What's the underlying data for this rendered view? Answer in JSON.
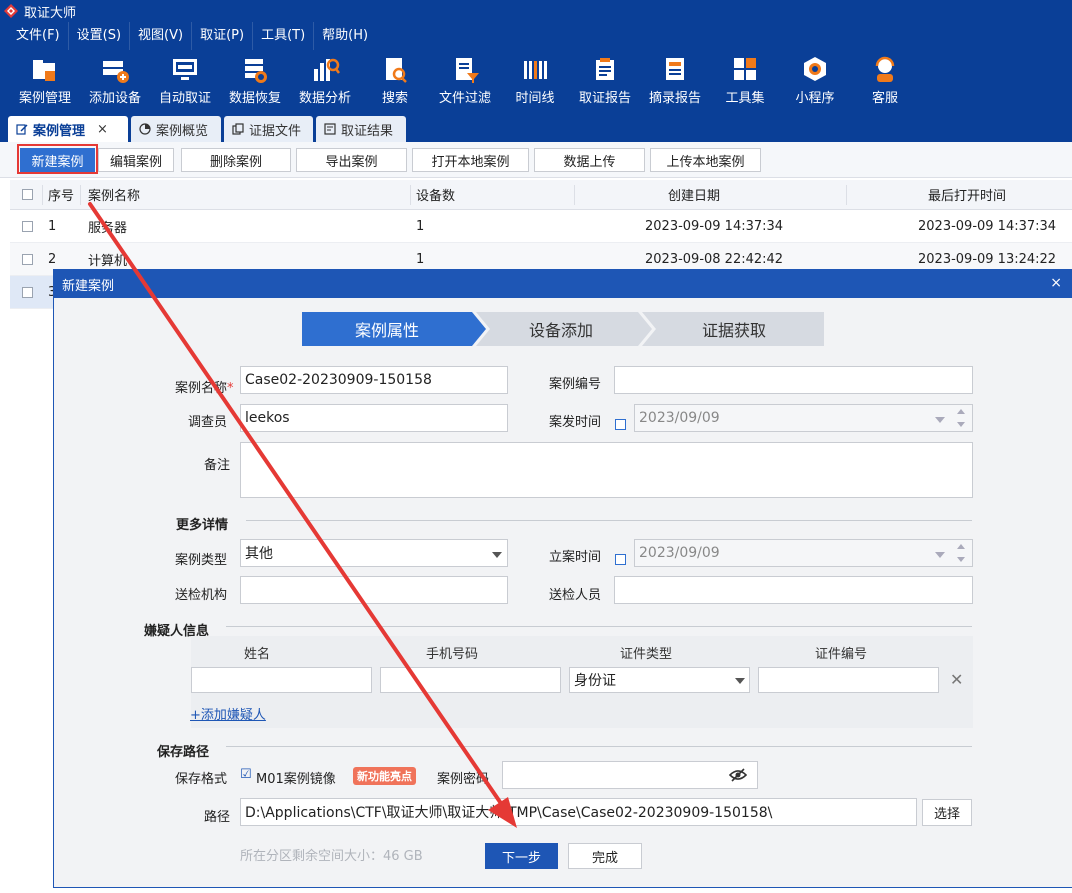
{
  "app": {
    "title": "取证大师"
  },
  "menu": [
    "文件(F)",
    "设置(S)",
    "视图(V)",
    "取证(P)",
    "工具(T)",
    "帮助(H)"
  ],
  "toolbar": [
    {
      "label": "案例管理",
      "icon": "folder-case-icon"
    },
    {
      "label": "添加设备",
      "icon": "add-device-icon"
    },
    {
      "label": "自动取证",
      "icon": "auto-monitor-icon"
    },
    {
      "label": "数据恢复",
      "icon": "data-recovery-icon"
    },
    {
      "label": "数据分析",
      "icon": "data-analysis-icon"
    },
    {
      "label": "搜索",
      "icon": "search-doc-icon"
    },
    {
      "label": "文件过滤",
      "icon": "file-filter-icon"
    },
    {
      "label": "时间线",
      "icon": "timeline-icon"
    },
    {
      "label": "取证报告",
      "icon": "report-icon"
    },
    {
      "label": "摘录报告",
      "icon": "excerpt-report-icon"
    },
    {
      "label": "工具集",
      "icon": "toolkit-icon"
    },
    {
      "label": "小程序",
      "icon": "mini-program-icon"
    },
    {
      "label": "客服",
      "icon": "customer-service-icon"
    }
  ],
  "tabs": [
    {
      "label": "案例管理",
      "icon": "edit-icon"
    },
    {
      "label": "案例概览",
      "icon": "chart-icon"
    },
    {
      "label": "证据文件",
      "icon": "file-icon"
    },
    {
      "label": "取证结果",
      "icon": "result-icon"
    }
  ],
  "actions": [
    "新建案例",
    "编辑案例",
    "删除案例",
    "导出案例",
    "打开本地案例",
    "数据上传",
    "上传本地案例"
  ],
  "table": {
    "headers": [
      "序号",
      "案例名称",
      "设备数",
      "创建日期",
      "最后打开时间"
    ],
    "rows": [
      [
        "1",
        "服务器",
        "1",
        "2023-09-09 14:37:34",
        "2023-09-09 14:37:34"
      ],
      [
        "2",
        "计算机",
        "1",
        "2023-09-08 22:42:42",
        "2023-09-09 13:24:22"
      ],
      [
        "3",
        "",
        "",
        "",
        ""
      ]
    ]
  },
  "dialog": {
    "title": "新建案例",
    "steps": [
      "案例属性",
      "设备添加",
      "证据获取"
    ],
    "labels": {
      "case_name": "案例名称",
      "required": "*",
      "case_number": "案例编号",
      "investigator": "调查员",
      "incident_time": "案发时间",
      "notes": "备注",
      "more_details": "更多详情",
      "case_type": "案例类型",
      "filing_time": "立案时间",
      "submit_org": "送检机构",
      "submit_person": "送检人员",
      "suspect_info": "嫌疑人信息",
      "save_path_section": "保存路径",
      "save_format": "保存格式",
      "case_password": "案例密码",
      "path": "路径"
    },
    "values": {
      "case_name": "Case02-20230909-150158",
      "case_number": "",
      "investigator": "leekos",
      "incident_time": "2023/09/09",
      "notes": "",
      "case_type": "其他",
      "filing_time": "2023/09/09",
      "submit_org": "",
      "submit_person": "",
      "password": "",
      "path": "D:\\Applications\\CTF\\取证大师\\取证大师\\TMP\\Case\\Case02-20230909-150158\\"
    },
    "suspect_columns": [
      "姓名",
      "手机号码",
      "证件类型",
      "证件编号"
    ],
    "suspect_row": {
      "name": "",
      "phone": "",
      "id_type": "身份证",
      "id_number": ""
    },
    "add_suspect": "+添加嫌疑人",
    "save_format_option": "M01案例镜像",
    "new_feature_badge": "新功能亮点",
    "choose_button": "选择",
    "free_space": "所在分区剩余空间大小：46 GB",
    "next_button": "下一步",
    "finish_button": "完成"
  },
  "colors": {
    "titlebar": "#0a3f97",
    "dialog_accent": "#1e56b5",
    "active_step": "#2f6fd0",
    "annotation": "#e53935",
    "badge": "#f0735a"
  }
}
